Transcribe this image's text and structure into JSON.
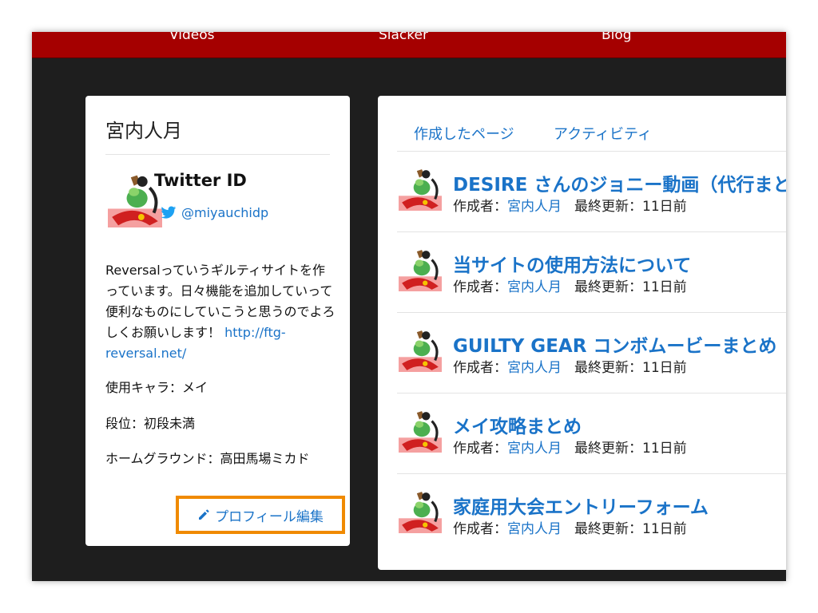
{
  "nav": {
    "items": [
      "Videos",
      "Slacker",
      "Blog"
    ]
  },
  "profile": {
    "name": "宮内人月",
    "twitter_label": "Twitter ID",
    "twitter_handle": "@miyauchidp",
    "bio_text": "Reversalっていうギルティサイトを作っています。日々機能を追加していって便利なものにしていこうと思うのでよろしくお願いします！ ",
    "bio_link": "http://ftg-reversal.net/",
    "character": "使用キャラ：メイ",
    "rank": "段位：初段未満",
    "home_ground": "ホームグラウンド：高田馬場ミカド",
    "edit_button": "プロフィール編集"
  },
  "pages": {
    "tabs": [
      "作成したページ",
      "アクティビティ"
    ],
    "items": [
      {
        "title": "DESIRE さんのジョニー動画（代行まとめ）",
        "author_label": "作成者：",
        "author": "宮内人月",
        "updated": "最終更新：11日前"
      },
      {
        "title": "当サイトの使用方法について",
        "author_label": "作成者：",
        "author": "宮内人月",
        "updated": "最終更新：11日前"
      },
      {
        "title": "GUILTY GEAR コンボムービーまとめ",
        "author_label": "作成者：",
        "author": "宮内人月",
        "updated": "最終更新：11日前"
      },
      {
        "title": "メイ攻略まとめ",
        "author_label": "作成者：",
        "author": "宮内人月",
        "updated": "最終更新：11日前"
      },
      {
        "title": "家庭用大会エントリーフォーム",
        "author_label": "作成者：",
        "author": "宮内人月",
        "updated": "最終更新：11日前"
      }
    ]
  },
  "colors": {
    "nav_bg": "#a50000",
    "page_bg": "#1e1e1e",
    "link": "#1a73c8",
    "highlight": "#f08a00"
  },
  "icons": [
    "twitter-bird-icon",
    "pencil-icon",
    "avatar-image"
  ]
}
